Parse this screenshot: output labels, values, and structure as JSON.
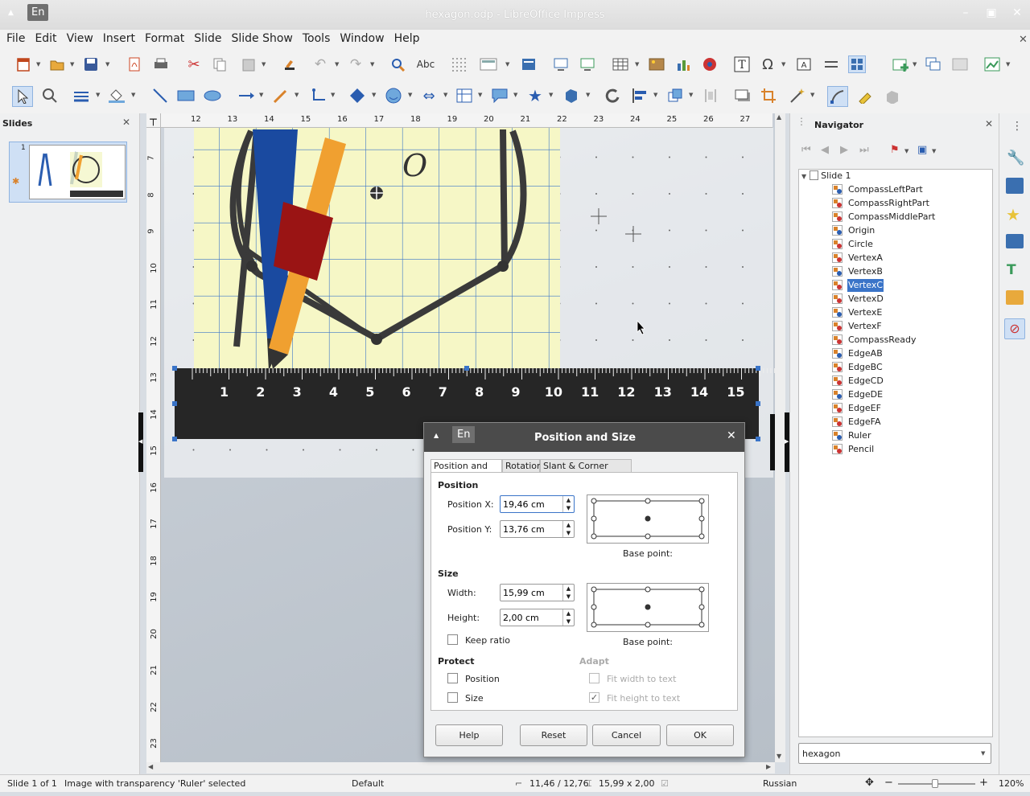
{
  "window": {
    "title": "hexagon.odp - LibreOffice Impress",
    "lang": "En"
  },
  "menu": [
    "File",
    "Edit",
    "View",
    "Insert",
    "Format",
    "Slide",
    "Slide Show",
    "Tools",
    "Window",
    "Help"
  ],
  "slides_pane": {
    "title": "Slides",
    "slide_number": "1"
  },
  "ruler": {
    "h": [
      "12",
      "13",
      "14",
      "15",
      "16",
      "17",
      "18",
      "19",
      "20",
      "21",
      "22",
      "23",
      "24",
      "25",
      "26",
      "27"
    ],
    "v": [
      "7",
      "8",
      "9",
      "10",
      "11",
      "12",
      "13",
      "14",
      "15",
      "16",
      "17",
      "18",
      "19",
      "20",
      "21",
      "22",
      "23"
    ]
  },
  "drawing": {
    "ruler_numbers": [
      "1",
      "2",
      "3",
      "4",
      "5",
      "6",
      "7",
      "8",
      "9",
      "10",
      "11",
      "12",
      "13",
      "14",
      "15"
    ],
    "origin_label": "O"
  },
  "navigator": {
    "title": "Navigator",
    "root": "Slide 1",
    "items": [
      "CompassLeftPart",
      "CompassRightPart",
      "CompassMiddlePart",
      "Origin",
      "Circle",
      "VertexA",
      "VertexB",
      "VertexC",
      "VertexD",
      "VertexE",
      "VertexF",
      "CompassReady",
      "EdgeAB",
      "EdgeBC",
      "EdgeCD",
      "EdgeDE",
      "EdgeEF",
      "EdgeFA",
      "Ruler",
      "Pencil"
    ],
    "selected": "VertexC",
    "document": "hexagon"
  },
  "dialog": {
    "lang": "En",
    "title": "Position and Size",
    "tabs": [
      "Position and Size",
      "Rotation",
      "Slant & Corner Radius"
    ],
    "position_header": "Position",
    "pos_x_label": "Position X:",
    "pos_x": "19,46 cm",
    "pos_y_label": "Position Y:",
    "pos_y": "13,76 cm",
    "base_point": "Base point:",
    "size_header": "Size",
    "width_label": "Width:",
    "width": "15,99 cm",
    "height_label": "Height:",
    "height": "2,00 cm",
    "keep_ratio": "Keep ratio",
    "protect_header": "Protect",
    "protect_position": "Position",
    "protect_size": "Size",
    "adapt_header": "Adapt",
    "fit_width": "Fit width to text",
    "fit_height": "Fit height to text",
    "buttons": {
      "help": "Help",
      "reset": "Reset",
      "cancel": "Cancel",
      "ok": "OK"
    }
  },
  "status": {
    "slide": "Slide 1 of 1",
    "selection": "Image with transparency 'Ruler' selected",
    "layout": "Default",
    "pos": "11,46 / 12,76",
    "size": "15,99 x 2,00",
    "language": "Russian",
    "zoom": "120%"
  }
}
